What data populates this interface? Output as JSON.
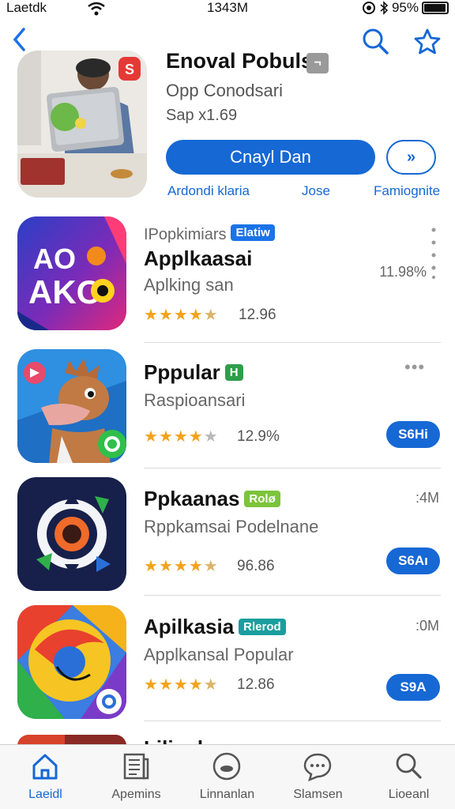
{
  "status_bar": {
    "carrier": "Laetdk",
    "time": "1343M",
    "battery": "95%",
    "battery_level": 0.95
  },
  "nav": {
    "back_icon": "chevron-left-icon",
    "search_icon": "search-icon",
    "favorite_icon": "star-icon"
  },
  "hero": {
    "title": "Enoval Pobuls",
    "badge": "¬",
    "subtitle": "Opp Conodsari",
    "size": "Sap x1.69",
    "cta_label": "Cnayl Dan",
    "share_label": "»",
    "links": [
      "Ardondi klaria",
      "Jose",
      "Famiognite"
    ]
  },
  "apps": [
    {
      "category": "IPopkimiars",
      "tag": "Elatiw",
      "tag_color": "#1a73e8",
      "title": "Applkaasai",
      "subtitle": "Aplking san",
      "stars": 4.5,
      "rating": "12.96",
      "size": "11.98%",
      "icon_text": "AO AKO"
    },
    {
      "title": "Pppular",
      "tag": "H",
      "tag_color": "#2e9e49",
      "subtitle": "Raspioansari",
      "stars": 4,
      "rating": "12.9%",
      "button": "S6Hi"
    },
    {
      "title": "Ppkaanas",
      "tag": "Rolø",
      "tag_color": "#7cc43a",
      "subtitle": "Rppkamsai Podelnane",
      "stars": 4.5,
      "rating": "96.86",
      "size": ":4M",
      "button": "S6Aı"
    },
    {
      "title": "Apilkasia",
      "tag": "Rlerod",
      "tag_color": "#1b9e9e",
      "subtitle": "Applkansal Popular",
      "stars": 4.5,
      "rating": "12.86",
      "size": ":0M",
      "button": "S9A"
    }
  ],
  "partial_row": {
    "title": "Lilianl"
  },
  "tabs": [
    {
      "label": "Laeidl",
      "icon": "home-icon",
      "active": true
    },
    {
      "label": "Apemins",
      "icon": "news-icon",
      "active": false
    },
    {
      "label": "Linnanlan",
      "icon": "games-icon",
      "active": false
    },
    {
      "label": "Slamsen",
      "icon": "chat-icon",
      "active": false
    },
    {
      "label": "Lioeanl",
      "icon": "search-icon",
      "active": false
    }
  ],
  "colors": {
    "accent": "#1668d4",
    "star": "#f4a21a",
    "star_off": "#b9b9b9"
  }
}
